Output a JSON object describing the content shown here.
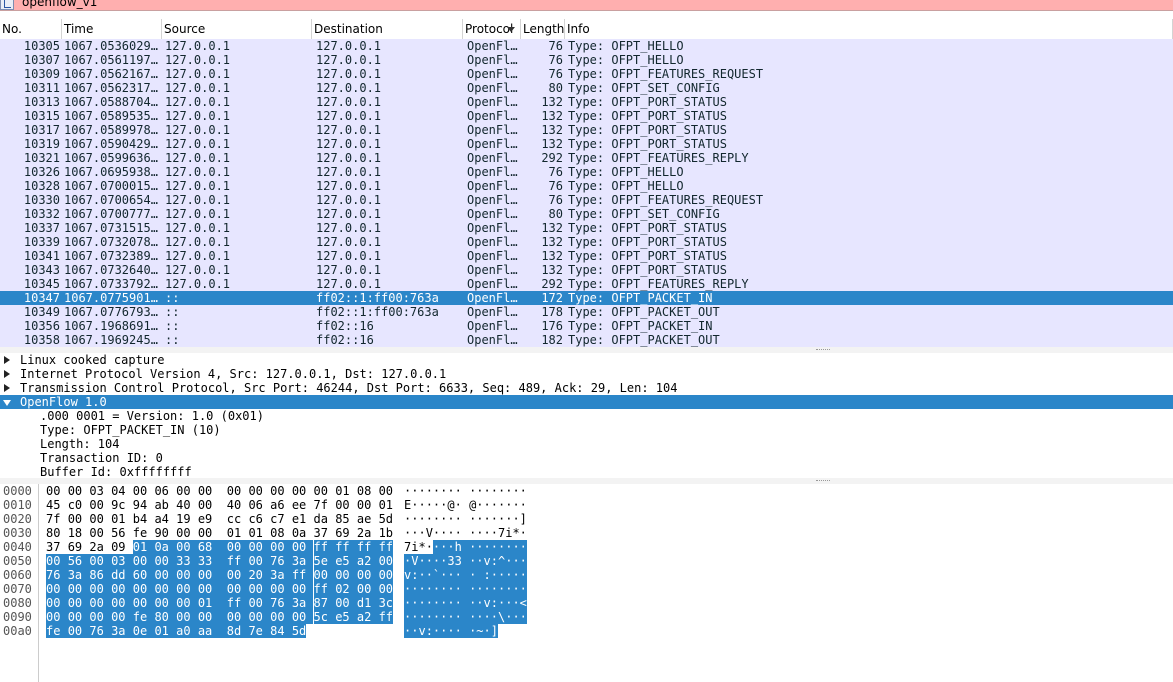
{
  "filter": {
    "value": "openflow_v1",
    "icon": "bookmark-icon"
  },
  "columns": [
    {
      "key": "no",
      "label": "No."
    },
    {
      "key": "time",
      "label": "Time"
    },
    {
      "key": "source",
      "label": "Source"
    },
    {
      "key": "destination",
      "label": "Destination"
    },
    {
      "key": "protocol",
      "label": "Protocol"
    },
    {
      "key": "length",
      "label": "Length"
    },
    {
      "key": "info",
      "label": "Info"
    }
  ],
  "packets": [
    {
      "no": "10305",
      "time": "1067.0536029…",
      "src": "127.0.0.1",
      "dst": "127.0.0.1",
      "proto": "OpenFl…",
      "len": "76",
      "info": "Type: OFPT_HELLO"
    },
    {
      "no": "10307",
      "time": "1067.0561197…",
      "src": "127.0.0.1",
      "dst": "127.0.0.1",
      "proto": "OpenFl…",
      "len": "76",
      "info": "Type: OFPT_HELLO"
    },
    {
      "no": "10309",
      "time": "1067.0562167…",
      "src": "127.0.0.1",
      "dst": "127.0.0.1",
      "proto": "OpenFl…",
      "len": "76",
      "info": "Type: OFPT_FEATURES_REQUEST"
    },
    {
      "no": "10311",
      "time": "1067.0562317…",
      "src": "127.0.0.1",
      "dst": "127.0.0.1",
      "proto": "OpenFl…",
      "len": "80",
      "info": "Type: OFPT_SET_CONFIG"
    },
    {
      "no": "10313",
      "time": "1067.0588704…",
      "src": "127.0.0.1",
      "dst": "127.0.0.1",
      "proto": "OpenFl…",
      "len": "132",
      "info": "Type: OFPT_PORT_STATUS"
    },
    {
      "no": "10315",
      "time": "1067.0589535…",
      "src": "127.0.0.1",
      "dst": "127.0.0.1",
      "proto": "OpenFl…",
      "len": "132",
      "info": "Type: OFPT_PORT_STATUS"
    },
    {
      "no": "10317",
      "time": "1067.0589978…",
      "src": "127.0.0.1",
      "dst": "127.0.0.1",
      "proto": "OpenFl…",
      "len": "132",
      "info": "Type: OFPT_PORT_STATUS"
    },
    {
      "no": "10319",
      "time": "1067.0590429…",
      "src": "127.0.0.1",
      "dst": "127.0.0.1",
      "proto": "OpenFl…",
      "len": "132",
      "info": "Type: OFPT_PORT_STATUS"
    },
    {
      "no": "10321",
      "time": "1067.0599636…",
      "src": "127.0.0.1",
      "dst": "127.0.0.1",
      "proto": "OpenFl…",
      "len": "292",
      "info": "Type: OFPT_FEATURES_REPLY"
    },
    {
      "no": "10326",
      "time": "1067.0695938…",
      "src": "127.0.0.1",
      "dst": "127.0.0.1",
      "proto": "OpenFl…",
      "len": "76",
      "info": "Type: OFPT_HELLO"
    },
    {
      "no": "10328",
      "time": "1067.0700015…",
      "src": "127.0.0.1",
      "dst": "127.0.0.1",
      "proto": "OpenFl…",
      "len": "76",
      "info": "Type: OFPT_HELLO"
    },
    {
      "no": "10330",
      "time": "1067.0700654…",
      "src": "127.0.0.1",
      "dst": "127.0.0.1",
      "proto": "OpenFl…",
      "len": "76",
      "info": "Type: OFPT_FEATURES_REQUEST"
    },
    {
      "no": "10332",
      "time": "1067.0700777…",
      "src": "127.0.0.1",
      "dst": "127.0.0.1",
      "proto": "OpenFl…",
      "len": "80",
      "info": "Type: OFPT_SET_CONFIG"
    },
    {
      "no": "10337",
      "time": "1067.0731515…",
      "src": "127.0.0.1",
      "dst": "127.0.0.1",
      "proto": "OpenFl…",
      "len": "132",
      "info": "Type: OFPT_PORT_STATUS"
    },
    {
      "no": "10339",
      "time": "1067.0732078…",
      "src": "127.0.0.1",
      "dst": "127.0.0.1",
      "proto": "OpenFl…",
      "len": "132",
      "info": "Type: OFPT_PORT_STATUS"
    },
    {
      "no": "10341",
      "time": "1067.0732389…",
      "src": "127.0.0.1",
      "dst": "127.0.0.1",
      "proto": "OpenFl…",
      "len": "132",
      "info": "Type: OFPT_PORT_STATUS"
    },
    {
      "no": "10343",
      "time": "1067.0732640…",
      "src": "127.0.0.1",
      "dst": "127.0.0.1",
      "proto": "OpenFl…",
      "len": "132",
      "info": "Type: OFPT_PORT_STATUS"
    },
    {
      "no": "10345",
      "time": "1067.0733792…",
      "src": "127.0.0.1",
      "dst": "127.0.0.1",
      "proto": "OpenFl…",
      "len": "292",
      "info": "Type: OFPT_FEATURES_REPLY"
    },
    {
      "no": "10347",
      "time": "1067.0775901…",
      "src": "::",
      "dst": "ff02::1:ff00:763a",
      "proto": "OpenFl…",
      "len": "172",
      "info": "Type: OFPT_PACKET_IN",
      "selected": true
    },
    {
      "no": "10349",
      "time": "1067.0776793…",
      "src": "::",
      "dst": "ff02::1:ff00:763a",
      "proto": "OpenFl…",
      "len": "178",
      "info": "Type: OFPT_PACKET_OUT"
    },
    {
      "no": "10356",
      "time": "1067.1968691…",
      "src": "::",
      "dst": "ff02::16",
      "proto": "OpenFl…",
      "len": "176",
      "info": "Type: OFPT_PACKET_IN"
    },
    {
      "no": "10358",
      "time": "1067.1969245…",
      "src": "::",
      "dst": "ff02::16",
      "proto": "OpenFl…",
      "len": "182",
      "info": "Type: OFPT_PACKET_OUT"
    }
  ],
  "details": [
    {
      "text": "Linux cooked capture",
      "state": "collapsed"
    },
    {
      "text": "Internet Protocol Version 4, Src: 127.0.0.1, Dst: 127.0.0.1",
      "state": "collapsed"
    },
    {
      "text": "Transmission Control Protocol, Src Port: 46244, Dst Port: 6633, Seq: 489, Ack: 29, Len: 104",
      "state": "collapsed"
    },
    {
      "text": "OpenFlow 1.0",
      "state": "expanded",
      "selected": true
    },
    {
      "text": ".000 0001 = Version: 1.0 (0x01)",
      "state": "leaf"
    },
    {
      "text": "Type: OFPT_PACKET_IN (10)",
      "state": "leaf"
    },
    {
      "text": "Length: 104",
      "state": "leaf"
    },
    {
      "text": "Transaction ID: 0",
      "state": "leaf"
    },
    {
      "text": "Buffer Id: 0xffffffff",
      "state": "leaf"
    }
  ],
  "bytes": {
    "highlight_start": 68,
    "rows": [
      {
        "offset": "0000",
        "hex": [
          "00",
          "00",
          "03",
          "04",
          "00",
          "06",
          "00",
          "00",
          "00",
          "00",
          "00",
          "00",
          "00",
          "01",
          "08",
          "00"
        ],
        "ascii": "········ ········"
      },
      {
        "offset": "0010",
        "hex": [
          "45",
          "c0",
          "00",
          "9c",
          "94",
          "ab",
          "40",
          "00",
          "40",
          "06",
          "a6",
          "ee",
          "7f",
          "00",
          "00",
          "01"
        ],
        "ascii": "E·····@· @·······"
      },
      {
        "offset": "0020",
        "hex": [
          "7f",
          "00",
          "00",
          "01",
          "b4",
          "a4",
          "19",
          "e9",
          "cc",
          "c6",
          "c7",
          "e1",
          "da",
          "85",
          "ae",
          "5d"
        ],
        "ascii": "········ ·······]"
      },
      {
        "offset": "0030",
        "hex": [
          "80",
          "18",
          "00",
          "56",
          "fe",
          "90",
          "00",
          "00",
          "01",
          "01",
          "08",
          "0a",
          "37",
          "69",
          "2a",
          "1b"
        ],
        "ascii": "···V···· ····7i*·"
      },
      {
        "offset": "0040",
        "hex": [
          "37",
          "69",
          "2a",
          "09",
          "01",
          "0a",
          "00",
          "68",
          "00",
          "00",
          "00",
          "00",
          "ff",
          "ff",
          "ff",
          "ff"
        ],
        "ascii": "7i*····h ········"
      },
      {
        "offset": "0050",
        "hex": [
          "00",
          "56",
          "00",
          "03",
          "00",
          "00",
          "33",
          "33",
          "ff",
          "00",
          "76",
          "3a",
          "5e",
          "e5",
          "a2",
          "00"
        ],
        "ascii": "·V····33 ··v:^···"
      },
      {
        "offset": "0060",
        "hex": [
          "76",
          "3a",
          "86",
          "dd",
          "60",
          "00",
          "00",
          "00",
          "00",
          "20",
          "3a",
          "ff",
          "00",
          "00",
          "00",
          "00"
        ],
        "ascii": "v:··`··· · :·····"
      },
      {
        "offset": "0070",
        "hex": [
          "00",
          "00",
          "00",
          "00",
          "00",
          "00",
          "00",
          "00",
          "00",
          "00",
          "00",
          "00",
          "ff",
          "02",
          "00",
          "00"
        ],
        "ascii": "········ ········"
      },
      {
        "offset": "0080",
        "hex": [
          "00",
          "00",
          "00",
          "00",
          "00",
          "00",
          "00",
          "01",
          "ff",
          "00",
          "76",
          "3a",
          "87",
          "00",
          "d1",
          "3c"
        ],
        "ascii": "········ ··v:···<"
      },
      {
        "offset": "0090",
        "hex": [
          "00",
          "00",
          "00",
          "00",
          "fe",
          "80",
          "00",
          "00",
          "00",
          "00",
          "00",
          "00",
          "5c",
          "e5",
          "a2",
          "ff"
        ],
        "ascii": "········ ····\\···"
      },
      {
        "offset": "00a0",
        "hex": [
          "fe",
          "00",
          "76",
          "3a",
          "0e",
          "01",
          "a0",
          "aa",
          "8d",
          "7e",
          "84",
          "5d"
        ],
        "ascii": "··v:···· ·~·]"
      }
    ]
  },
  "colors": {
    "row_bg": "#e7e6ff",
    "selected_bg": "#2b86c9",
    "filter_bg": "#ffafaf"
  }
}
